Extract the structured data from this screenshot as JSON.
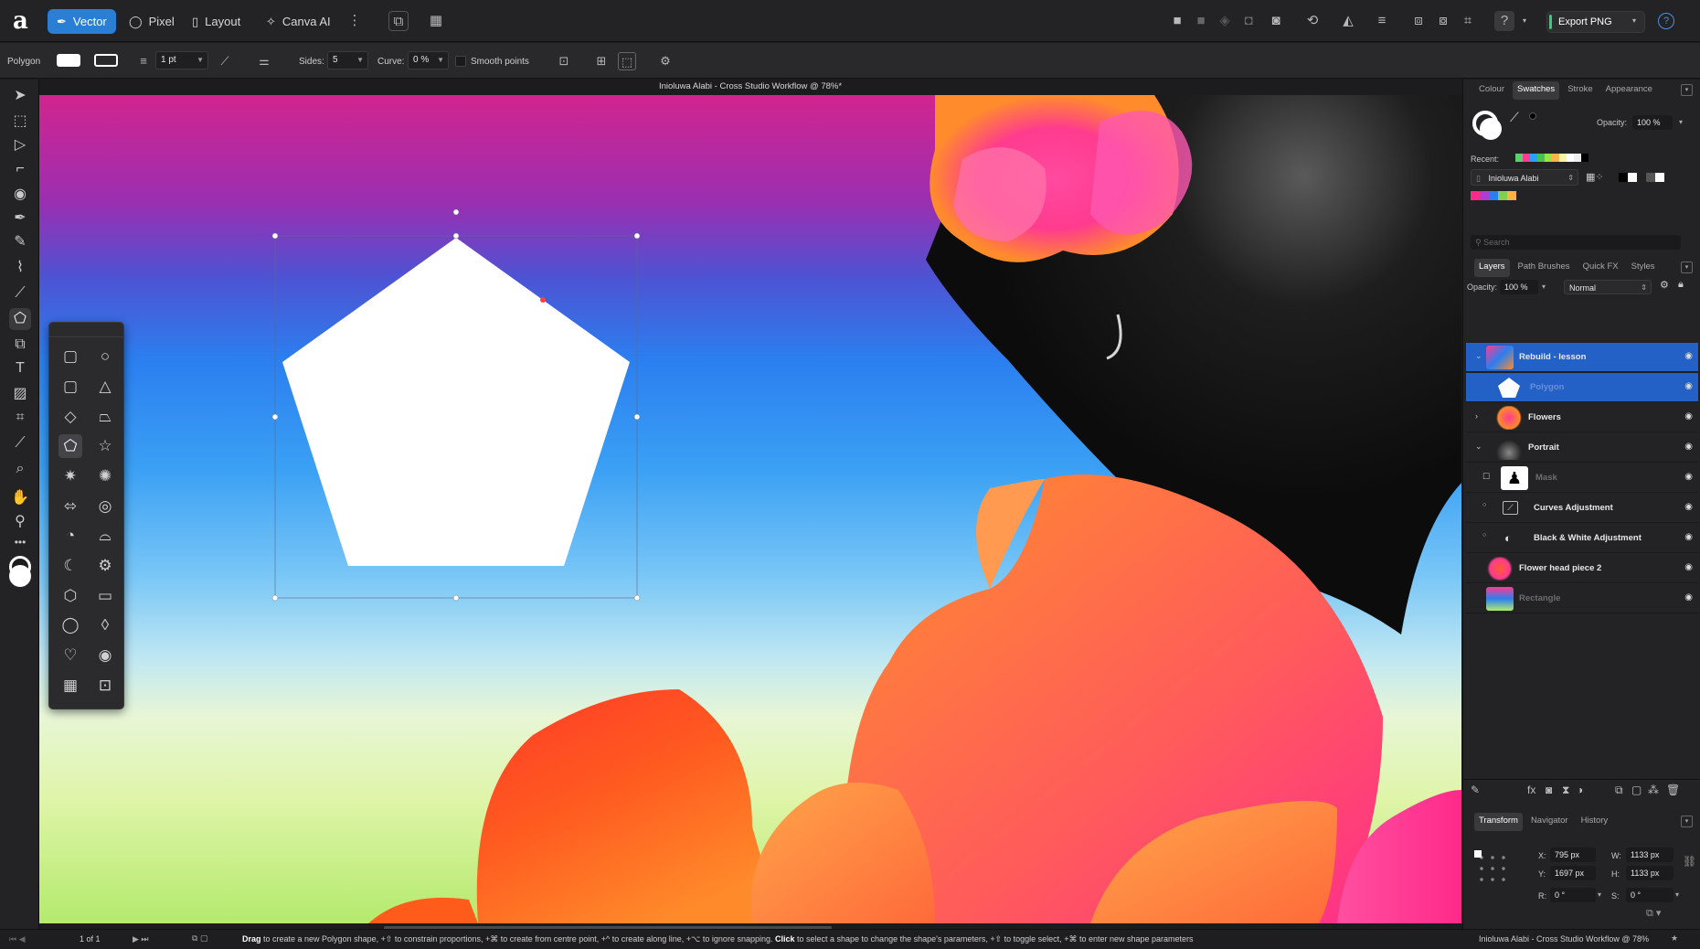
{
  "app": {
    "logo": "a",
    "personas": [
      {
        "label": "Vector",
        "icon": "vector-icon",
        "glyph": "✒"
      },
      {
        "label": "Pixel",
        "icon": "pixel-icon",
        "glyph": "◯"
      },
      {
        "label": "Layout",
        "icon": "layout-icon",
        "glyph": "▯"
      },
      {
        "label": "Canva AI",
        "icon": "canva-ai-icon",
        "glyph": "✧"
      }
    ],
    "export_label": "Export PNG",
    "accent_color": "#2a7fd4"
  },
  "context_bar": {
    "tool_name": "Polygon",
    "stroke_width": "1 pt",
    "sides_label": "Sides:",
    "sides_value": "5",
    "curve_label": "Curve:",
    "curve_value": "0 %",
    "smooth_points_label": "Smooth points"
  },
  "document": {
    "title": "Inioluwa Alabi - Cross Studio Workflow @ 78%*",
    "page_indicator": "1 of 1"
  },
  "right_panel": {
    "color_tabs": [
      "Colour",
      "Swatches",
      "Stroke",
      "Appearance"
    ],
    "color_active_tab": "Swatches",
    "opacity_label": "Opacity:",
    "opacity_value": "100 %",
    "recent_label": "Recent:",
    "palette_name": "Inioluwa Alabi",
    "search_placeholder": "Search",
    "layer_tabs": [
      "Layers",
      "Path Brushes",
      "Quick FX",
      "Styles"
    ],
    "layers_active_tab": "Layers",
    "layers_opacity_label": "Opacity:",
    "layers_opacity_value": "100 %",
    "blend_mode": "Normal",
    "layers": [
      {
        "name": "Rebuild - lesson",
        "selected": true,
        "dim": false
      },
      {
        "name": "Polygon",
        "selected": true,
        "dim": true
      },
      {
        "name": "Flowers",
        "selected": false,
        "dim": false
      },
      {
        "name": "Portrait",
        "selected": false,
        "dim": false
      },
      {
        "name": "Mask",
        "selected": false,
        "dim": true
      },
      {
        "name": "Curves Adjustment",
        "selected": false,
        "dim": false
      },
      {
        "name": "Black & White Adjustment",
        "selected": false,
        "dim": false
      },
      {
        "name": "Flower head piece 2",
        "selected": false,
        "dim": false
      },
      {
        "name": "Rectangle",
        "selected": false,
        "dim": true
      }
    ],
    "transform_tabs": [
      "Transform",
      "Navigator",
      "History"
    ],
    "transform_active_tab": "Transform",
    "transform": {
      "x_label": "X:",
      "x_value": "795 px",
      "y_label": "Y:",
      "y_value": "1697 px",
      "w_label": "W:",
      "w_value": "1133 px",
      "h_label": "H:",
      "h_value": "1133 px",
      "r_label": "R:",
      "r_value": "0 °",
      "s_label": "S:",
      "s_value": "0 °"
    }
  },
  "status_bar": {
    "hint_segments": [
      {
        "text": "Drag",
        "bold": true
      },
      {
        "text": " to create a new Polygon shape, +⇧ to constrain proportions, +⌘ to create from centre point, +^ to create along line, +⌥ to ignore snapping. ",
        "bold": false
      },
      {
        "text": "Click",
        "bold": true
      },
      {
        "text": " to select a shape to change the shape's parameters, +⇧ to toggle select, +⌘ to enter new shape parameters",
        "bold": false
      }
    ],
    "right_title": "Inioluwa Alabi - Cross Studio Workflow @ 78%"
  }
}
